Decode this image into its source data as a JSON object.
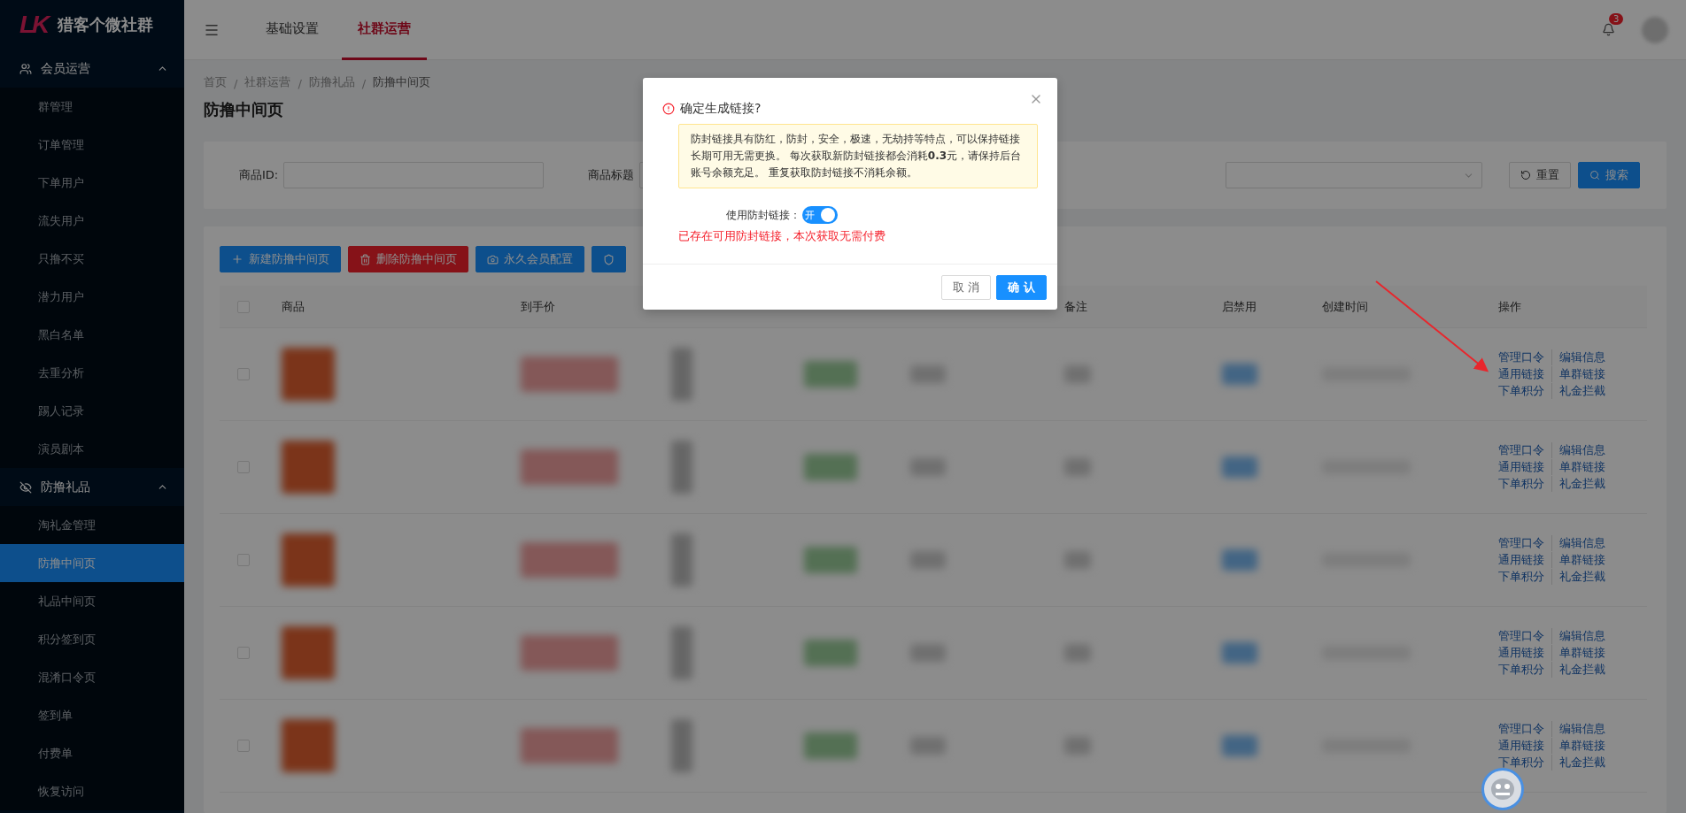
{
  "app": {
    "logo_text": "LK",
    "name": "猎客个微社群"
  },
  "sidebar": {
    "groups": [
      {
        "label": "会员运营",
        "expanded": true,
        "items": [
          {
            "label": "群管理",
            "selected": false
          },
          {
            "label": "订单管理",
            "selected": false
          },
          {
            "label": "下单用户",
            "selected": false
          },
          {
            "label": "流失用户",
            "selected": false
          },
          {
            "label": "只撸不买",
            "selected": false
          },
          {
            "label": "潜力用户",
            "selected": false
          },
          {
            "label": "黑白名单",
            "selected": false
          },
          {
            "label": "去重分析",
            "selected": false
          },
          {
            "label": "踢人记录",
            "selected": false
          },
          {
            "label": "演员剧本",
            "selected": false
          }
        ]
      },
      {
        "label": "防撸礼品",
        "expanded": true,
        "items": [
          {
            "label": "淘礼金管理",
            "selected": false
          },
          {
            "label": "防撸中间页",
            "selected": true
          },
          {
            "label": "礼品中间页",
            "selected": false
          },
          {
            "label": "积分签到页",
            "selected": false
          },
          {
            "label": "混淆口令页",
            "selected": false
          },
          {
            "label": "签到单",
            "selected": false
          },
          {
            "label": "付费单",
            "selected": false
          },
          {
            "label": "恢复访问",
            "selected": false
          }
        ]
      }
    ]
  },
  "top_tabs": [
    {
      "label": "基础设置",
      "selected": false
    },
    {
      "label": "社群运营",
      "selected": true
    }
  ],
  "notifications": {
    "count": "3"
  },
  "breadcrumb": {
    "separator": "/",
    "items": [
      "首页",
      "社群运营",
      "防撸礼品",
      "防撸中间页"
    ]
  },
  "page_title": "防撸中间页",
  "search": {
    "fields": [
      {
        "label": "商品ID:"
      },
      {
        "label": "商品标题"
      }
    ],
    "buttons": [
      {
        "label": "重置",
        "kind": "reset"
      },
      {
        "label": "搜索",
        "kind": "search"
      }
    ]
  },
  "toolbar": [
    {
      "label": "新建防撸中间页",
      "kind": "add"
    },
    {
      "label": "删除防撸中间页",
      "kind": "delete"
    },
    {
      "label": "永久会员配置",
      "kind": "member"
    },
    {
      "kind": "shield"
    }
  ],
  "table": {
    "all_checked": false,
    "columns": [
      "商品",
      "到手价",
      "",
      "",
      "",
      "备注",
      "启禁用",
      "创建时间",
      "操作"
    ],
    "rows": [
      {
        "checked": false,
        "actions": [
          "管理口令",
          "编辑信息",
          "通用链接",
          "单群链接",
          "下单积分",
          "礼金拦截"
        ]
      },
      {
        "checked": false,
        "actions": [
          "管理口令",
          "编辑信息",
          "通用链接",
          "单群链接",
          "下单积分",
          "礼金拦截"
        ]
      },
      {
        "checked": false,
        "actions": [
          "管理口令",
          "编辑信息",
          "通用链接",
          "单群链接",
          "下单积分",
          "礼金拦截"
        ]
      },
      {
        "checked": false,
        "actions": [
          "管理口令",
          "编辑信息",
          "通用链接",
          "单群链接",
          "下单积分",
          "礼金拦截"
        ]
      },
      {
        "checked": false,
        "actions": [
          "管理口令",
          "编辑信息",
          "通用链接",
          "单群链接",
          "下单积分",
          "礼金拦截"
        ]
      }
    ]
  },
  "modal": {
    "title": "确定生成链接?",
    "notice": "防封链接具有防红，防封，安全，极速，无劫持等特点，可以保持链接长期可用无需更换。 每次获取新防封链接都会消耗**0.3**元，请保持后台账号余额充足。 重复获取防封链接不消耗余额。",
    "switch": {
      "label": "使用防封链接：",
      "on": true,
      "on_text": "开"
    },
    "hint": "已存在可用防封链接，本次获取无需付费",
    "buttons": [
      {
        "label": "取 消",
        "kind": "default"
      },
      {
        "label": "确 认",
        "kind": "primary"
      }
    ]
  }
}
